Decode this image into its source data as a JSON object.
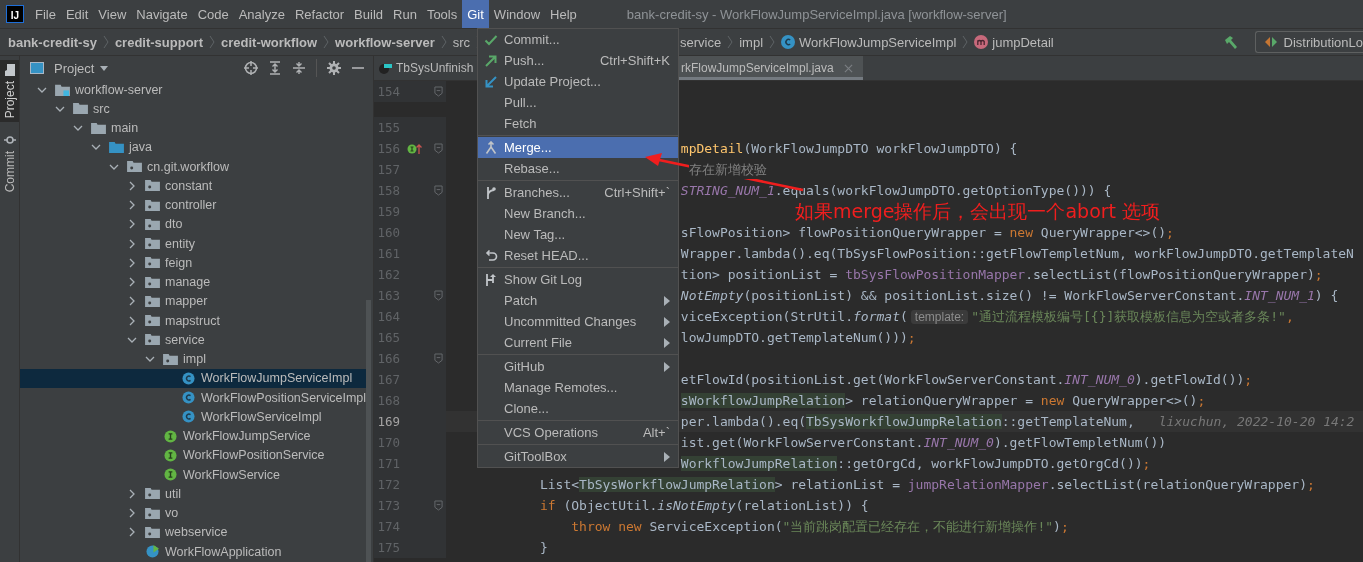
{
  "app_logo": "IJ",
  "menu_bar": [
    {
      "label": "File",
      "selected": false
    },
    {
      "label": "Edit",
      "selected": false
    },
    {
      "label": "View",
      "selected": false
    },
    {
      "label": "Navigate",
      "selected": false
    },
    {
      "label": "Code",
      "selected": false
    },
    {
      "label": "Analyze",
      "selected": false
    },
    {
      "label": "Refactor",
      "selected": false
    },
    {
      "label": "Build",
      "selected": false
    },
    {
      "label": "Run",
      "selected": false
    },
    {
      "label": "Tools",
      "selected": false
    },
    {
      "label": "Git",
      "selected": true
    },
    {
      "label": "Window",
      "selected": false
    },
    {
      "label": "Help",
      "selected": false
    }
  ],
  "window_title": "bank-credit-sy - WorkFlowJumpServiceImpl.java [workflow-server]",
  "breadcrumbs": [
    {
      "label": "bank-credit-sy",
      "kind": "module"
    },
    {
      "label": "credit-support",
      "kind": "module"
    },
    {
      "label": "credit-workflow",
      "kind": "module"
    },
    {
      "label": "workflow-server",
      "kind": "module"
    },
    {
      "label": "src",
      "kind": "folder"
    }
  ],
  "breadcrumbs_right": [
    {
      "label": "service",
      "kind": "folder"
    },
    {
      "label": "impl",
      "kind": "folder"
    },
    {
      "label": "WorkFlowJumpServiceImpl",
      "kind": "class"
    },
    {
      "label": "jumpDetail",
      "kind": "method"
    }
  ],
  "run_config": "DistributionLo",
  "tool_tabs": [
    {
      "label": "Project",
      "selected": true
    },
    {
      "label": "Commit",
      "selected": false
    }
  ],
  "project_panel": {
    "title": "Project",
    "tree": [
      {
        "label": "workflow-server",
        "kind": "module",
        "expanded": true,
        "selected": false,
        "children": [
          {
            "label": "src",
            "kind": "folder",
            "expanded": true,
            "selected": false,
            "children": [
              {
                "label": "main",
                "kind": "folder",
                "expanded": true,
                "selected": false,
                "children": [
                  {
                    "label": "java",
                    "kind": "source",
                    "expanded": true,
                    "selected": false,
                    "children": [
                      {
                        "label": "cn.git.workflow",
                        "kind": "package",
                        "expanded": true,
                        "selected": false,
                        "children": [
                          {
                            "label": "constant",
                            "kind": "package",
                            "expanded": false,
                            "selected": false
                          },
                          {
                            "label": "controller",
                            "kind": "package",
                            "expanded": false,
                            "selected": false
                          },
                          {
                            "label": "dto",
                            "kind": "package",
                            "expanded": false,
                            "selected": false
                          },
                          {
                            "label": "entity",
                            "kind": "package",
                            "expanded": false,
                            "selected": false
                          },
                          {
                            "label": "feign",
                            "kind": "package",
                            "expanded": false,
                            "selected": false
                          },
                          {
                            "label": "manage",
                            "kind": "package",
                            "expanded": false,
                            "selected": false
                          },
                          {
                            "label": "mapper",
                            "kind": "package",
                            "expanded": false,
                            "selected": false
                          },
                          {
                            "label": "mapstruct",
                            "kind": "package",
                            "expanded": false,
                            "selected": false
                          },
                          {
                            "label": "service",
                            "kind": "package",
                            "expanded": true,
                            "selected": false,
                            "children": [
                              {
                                "label": "impl",
                                "kind": "package",
                                "expanded": true,
                                "selected": false,
                                "children": [
                                  {
                                    "label": "WorkFlowJumpServiceImpl",
                                    "kind": "class",
                                    "selected": true
                                  },
                                  {
                                    "label": "WorkFlowPositionServiceImpl",
                                    "kind": "class",
                                    "selected": false
                                  },
                                  {
                                    "label": "WorkFlowServiceImpl",
                                    "kind": "class",
                                    "selected": false
                                  }
                                ]
                              },
                              {
                                "label": "WorkFlowJumpService",
                                "kind": "interface",
                                "selected": false
                              },
                              {
                                "label": "WorkFlowPositionService",
                                "kind": "interface",
                                "selected": false
                              },
                              {
                                "label": "WorkFlowService",
                                "kind": "interface",
                                "selected": false
                              }
                            ]
                          },
                          {
                            "label": "util",
                            "kind": "package",
                            "expanded": false,
                            "selected": false
                          },
                          {
                            "label": "vo",
                            "kind": "package",
                            "expanded": false,
                            "selected": false
                          },
                          {
                            "label": "webservice",
                            "kind": "package",
                            "expanded": false,
                            "selected": false
                          },
                          {
                            "label": "WorkFlowApplication",
                            "kind": "app",
                            "selected": false
                          }
                        ]
                      }
                    ]
                  }
                ]
              }
            ]
          }
        ]
      }
    ]
  },
  "editor_tabs": [
    {
      "label": "TbSysUnfinish",
      "selected": false
    },
    {
      "label": "rkFlowJumpServiceImpl.java",
      "selected": true
    }
  ],
  "code_lines": [
    {
      "number": "154",
      "current": false,
      "fold": true,
      "marker": false
    },
    {
      "number": "155",
      "current": false,
      "fold": false,
      "marker": false
    },
    {
      "number": "156",
      "current": false,
      "fold": true,
      "marker": true,
      "tokens": [
        {
          "text": "                              mpDetail",
          "kind": "method"
        },
        {
          "text": "(WorkFlowJumpDTO workFlowJumpDTO) {",
          "kind": "plain"
        }
      ]
    },
    {
      "number": "157",
      "current": false,
      "fold": false,
      "marker": false,
      "tokens": [
        {
          "text": "                               存在新增校验",
          "kind": "comment"
        }
      ]
    },
    {
      "number": "158",
      "current": false,
      "fold": true,
      "marker": false,
      "tokens": [
        {
          "text": "                              STRING_NUM_1",
          "kind": "constant"
        },
        {
          "text": ".equals(workFlowJumpDTO.getOptionType())) {",
          "kind": "plain"
        }
      ]
    },
    {
      "number": "159",
      "current": false,
      "fold": false,
      "marker": false
    },
    {
      "number": "160",
      "current": false,
      "fold": false,
      "marker": false,
      "tokens": [
        {
          "text": "                              sFlowPosition> flowPositionQueryWrapper = ",
          "kind": "plain"
        },
        {
          "text": "new",
          "kind": "keyword"
        },
        {
          "text": " QueryWrapper<>()",
          "kind": "plain"
        },
        {
          "text": ";",
          "kind": "keyword"
        }
      ]
    },
    {
      "number": "161",
      "current": false,
      "fold": false,
      "marker": false,
      "tokens": [
        {
          "text": "                              Wrapper.lambda().eq(TbSysFlowPosition::getFlowTempletNum, workFlowJumpDTO.getTemplateN",
          "kind": "plain"
        }
      ]
    },
    {
      "number": "162",
      "current": false,
      "fold": false,
      "marker": false,
      "tokens": [
        {
          "text": "                              tion> positionList = ",
          "kind": "plain"
        },
        {
          "text": "tbSysFlowPositionMapper",
          "kind": "field"
        },
        {
          "text": ".selectList(flowPositionQueryWrapper)",
          "kind": "plain"
        },
        {
          "text": ";",
          "kind": "keyword"
        }
      ]
    },
    {
      "number": "163",
      "current": false,
      "fold": true,
      "marker": false,
      "tokens": [
        {
          "text": "                              NotEmpty",
          "kind": "static"
        },
        {
          "text": "(positionList) && positionList.size() != WorkFlowServerConstant.",
          "kind": "plain"
        },
        {
          "text": "INT_NUM_1",
          "kind": "constant"
        },
        {
          "text": ") {",
          "kind": "plain"
        }
      ]
    },
    {
      "number": "164",
      "current": false,
      "fold": false,
      "marker": false,
      "tokens": [
        {
          "text": "                              viceException(StrUtil.",
          "kind": "plain"
        },
        {
          "text": "format",
          "kind": "static"
        },
        {
          "text": "(",
          "kind": "plain"
        },
        {
          "text": "template:",
          "kind": "hint"
        },
        {
          "text": "\"通过流程模板编号[{}]获取模板信息为空或者多条!\"",
          "kind": "string"
        },
        {
          "text": ",",
          "kind": "keyword"
        }
      ]
    },
    {
      "number": "165",
      "current": false,
      "fold": false,
      "marker": false,
      "tokens": [
        {
          "text": "                              lowJumpDTO.getTemplateNum()))",
          "kind": "plain"
        },
        {
          "text": ";",
          "kind": "keyword"
        }
      ]
    },
    {
      "number": "166",
      "current": false,
      "fold": true,
      "marker": false
    },
    {
      "number": "167",
      "current": false,
      "fold": false,
      "marker": false,
      "tokens": [
        {
          "text": "                              etFlowId(positionList.get(WorkFlowServerConstant.",
          "kind": "plain"
        },
        {
          "text": "INT_NUM_0",
          "kind": "constant"
        },
        {
          "text": ").getFlowId())",
          "kind": "plain"
        },
        {
          "text": ";",
          "kind": "keyword"
        }
      ]
    },
    {
      "number": "168",
      "current": false,
      "fold": false,
      "marker": false,
      "tokens": [
        {
          "text": "                              sWorkflowJumpRelation",
          "kind": "usage"
        },
        {
          "text": "> relationQueryWrapper = ",
          "kind": "plain"
        },
        {
          "text": "new",
          "kind": "keyword"
        },
        {
          "text": " QueryWrapper<>()",
          "kind": "plain"
        },
        {
          "text": ";",
          "kind": "keyword"
        }
      ]
    },
    {
      "number": "169",
      "current": true,
      "fold": false,
      "marker": false,
      "tokens": [
        {
          "text": "                              per.lambda().eq(",
          "kind": "plain"
        },
        {
          "text": "TbSysWorkflowJumpRelation",
          "kind": "usage"
        },
        {
          "text": "::getTemplateNum,",
          "kind": "plain"
        },
        {
          "text": "lixuchun, 2022-10-20 14:2",
          "kind": "blame"
        }
      ]
    },
    {
      "number": "170",
      "current": false,
      "fold": false,
      "marker": false,
      "tokens": [
        {
          "text": "                              ist.get(WorkFlowServerConstant.",
          "kind": "plain"
        },
        {
          "text": "INT_NUM_0",
          "kind": "constant"
        },
        {
          "text": ").getFlowTempletNum())",
          "kind": "plain"
        }
      ]
    },
    {
      "number": "171",
      "current": false,
      "fold": false,
      "marker": false,
      "tokens": [
        {
          "text": "                              WorkflowJumpRelation",
          "kind": "usage"
        },
        {
          "text": "::getOrgCd, workFlowJumpDTO.getOrgCd())",
          "kind": "plain"
        },
        {
          "text": ";",
          "kind": "keyword"
        }
      ]
    },
    {
      "number": "172",
      "current": false,
      "fold": false,
      "marker": false,
      "tokens": [
        {
          "text": "            List<",
          "kind": "plain"
        },
        {
          "text": "TbSysWorkflowJumpRelation",
          "kind": "usage"
        },
        {
          "text": "> relationList = ",
          "kind": "plain"
        },
        {
          "text": "jumpRelationMapper",
          "kind": "field"
        },
        {
          "text": ".selectList(relationQueryWrapper)",
          "kind": "plain"
        },
        {
          "text": ";",
          "kind": "keyword"
        }
      ]
    },
    {
      "number": "173",
      "current": false,
      "fold": true,
      "marker": false,
      "tokens": [
        {
          "text": "            if",
          "kind": "keyword"
        },
        {
          "text": " (ObjectUtil.",
          "kind": "plain"
        },
        {
          "text": "isNotEmpty",
          "kind": "static"
        },
        {
          "text": "(relationList)) {",
          "kind": "plain"
        }
      ]
    },
    {
      "number": "174",
      "current": false,
      "fold": false,
      "marker": false,
      "tokens": [
        {
          "text": "                throw new",
          "kind": "keyword"
        },
        {
          "text": " ServiceException(",
          "kind": "plain"
        },
        {
          "text": "\"当前跳岗配置已经存在，不能进行新增操作!\"",
          "kind": "string"
        },
        {
          "text": ")",
          "kind": "plain"
        },
        {
          "text": ";",
          "kind": "keyword"
        }
      ]
    },
    {
      "number": "175",
      "current": false,
      "fold": false,
      "marker": false,
      "tokens": [
        {
          "text": "            }",
          "kind": "plain"
        }
      ]
    }
  ],
  "git_menu": [
    {
      "label": "Commit...",
      "kind": "commit",
      "submenu": false,
      "selected": false
    },
    {
      "label": "Push...",
      "kind": "push",
      "shortcut": "Ctrl+Shift+K",
      "submenu": false,
      "selected": false
    },
    {
      "label": "Update Project...",
      "kind": "update",
      "submenu": false,
      "selected": false
    },
    {
      "label": "Pull...",
      "kind": "plain",
      "submenu": false,
      "selected": false
    },
    {
      "label": "Fetch",
      "kind": "plain",
      "submenu": false,
      "selected": false
    },
    {
      "kind": "separator"
    },
    {
      "label": "Merge...",
      "kind": "merge",
      "submenu": false,
      "selected": true
    },
    {
      "label": "Rebase...",
      "kind": "plain",
      "submenu": false,
      "selected": false
    },
    {
      "kind": "separator"
    },
    {
      "label": "Branches...",
      "kind": "branch",
      "shortcut": "Ctrl+Shift+`",
      "submenu": false,
      "selected": false
    },
    {
      "label": "New Branch...",
      "kind": "plain",
      "submenu": false,
      "selected": false
    },
    {
      "label": "New Tag...",
      "kind": "plain",
      "submenu": false,
      "selected": false
    },
    {
      "label": "Reset HEAD...",
      "kind": "reset",
      "submenu": false,
      "selected": false
    },
    {
      "kind": "separator"
    },
    {
      "label": "Show Git Log",
      "kind": "log",
      "submenu": false,
      "selected": false
    },
    {
      "label": "Patch",
      "kind": "plain",
      "submenu": true,
      "selected": false
    },
    {
      "label": "Uncommitted Changes",
      "kind": "plain",
      "submenu": true,
      "selected": false
    },
    {
      "label": "Current File",
      "kind": "plain",
      "submenu": true,
      "selected": false
    },
    {
      "kind": "separator"
    },
    {
      "label": "GitHub",
      "kind": "plain",
      "submenu": true,
      "selected": false
    },
    {
      "label": "Manage Remotes...",
      "kind": "plain",
      "submenu": false,
      "selected": false
    },
    {
      "label": "Clone...",
      "kind": "plain",
      "submenu": false,
      "selected": false
    },
    {
      "kind": "separator"
    },
    {
      "label": "VCS Operations",
      "kind": "plain",
      "shortcut": "Alt+`",
      "submenu": false,
      "selected": false
    },
    {
      "kind": "separator"
    },
    {
      "label": "GitToolBox",
      "kind": "plain",
      "submenu": true,
      "selected": false
    }
  ],
  "annotation": {
    "text": "如果merge操作后，会出现一个abort 选项"
  }
}
